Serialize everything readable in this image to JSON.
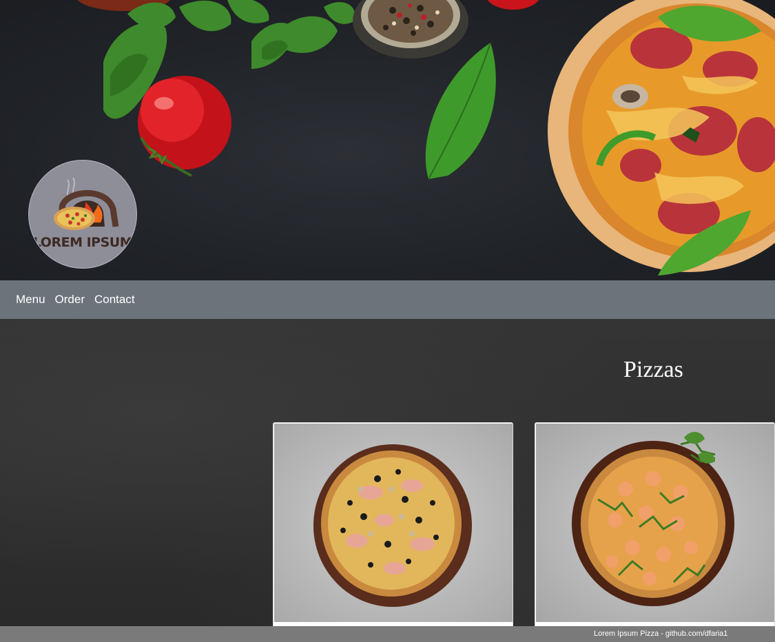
{
  "brand": {
    "logo_text": "LOREM IPSUM"
  },
  "nav": {
    "items": [
      {
        "label": "Menu"
      },
      {
        "label": "Order"
      },
      {
        "label": "Contact"
      }
    ]
  },
  "main": {
    "section_title": "Pizzas",
    "cards": [
      {
        "image": "pizza-olives-ham-mushroom"
      },
      {
        "image": "pizza-shrimp-arugula"
      }
    ]
  },
  "footer": {
    "text": "Lorem Ipsum Pizza - github.com/dfaria1"
  },
  "colors": {
    "nav_background": "#6c737b",
    "footer_background": "#7a7a7a",
    "hero_background": "#202328",
    "logo_circle": "#8e8e99"
  }
}
